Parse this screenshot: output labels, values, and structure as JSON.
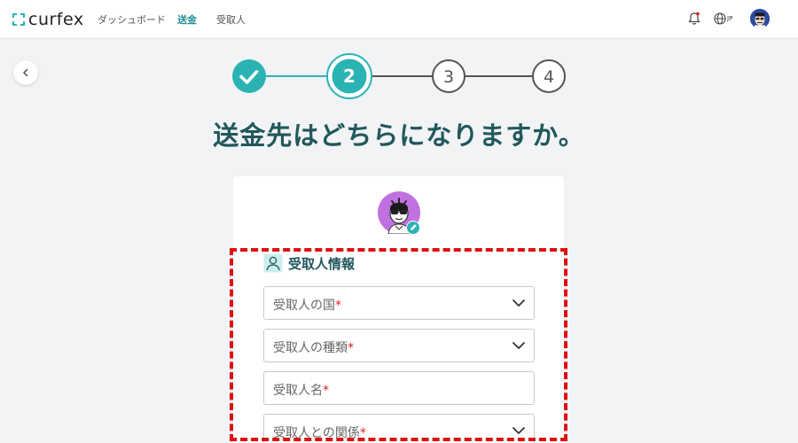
{
  "brand": {
    "name": "curfex"
  },
  "nav": {
    "items": [
      {
        "label": "ダッシュボード",
        "active": false
      },
      {
        "label": "送金",
        "active": true
      },
      {
        "label": "受取人",
        "active": false
      }
    ],
    "language": "JP"
  },
  "stepper": {
    "steps": [
      {
        "number": "1",
        "state": "done"
      },
      {
        "number": "2",
        "state": "current"
      },
      {
        "number": "3",
        "state": "upcoming"
      },
      {
        "number": "4",
        "state": "upcoming"
      }
    ]
  },
  "page": {
    "title": "送金先はどちらになりますか。"
  },
  "section": {
    "title": "受取人情報"
  },
  "form": {
    "fields": [
      {
        "label": "受取人の国",
        "required_mark": "*",
        "type": "select"
      },
      {
        "label": "受取人の種類",
        "required_mark": "*",
        "type": "select"
      },
      {
        "label": "受取人名",
        "required_mark": "*",
        "type": "text"
      },
      {
        "label": "受取人との関係",
        "required_mark": "*",
        "type": "select"
      }
    ]
  },
  "colors": {
    "accent": "#2bb3b4",
    "title": "#21585c",
    "required": "#e02020",
    "highlight": "#dd1111",
    "avatar_bg": "#c071e0"
  }
}
